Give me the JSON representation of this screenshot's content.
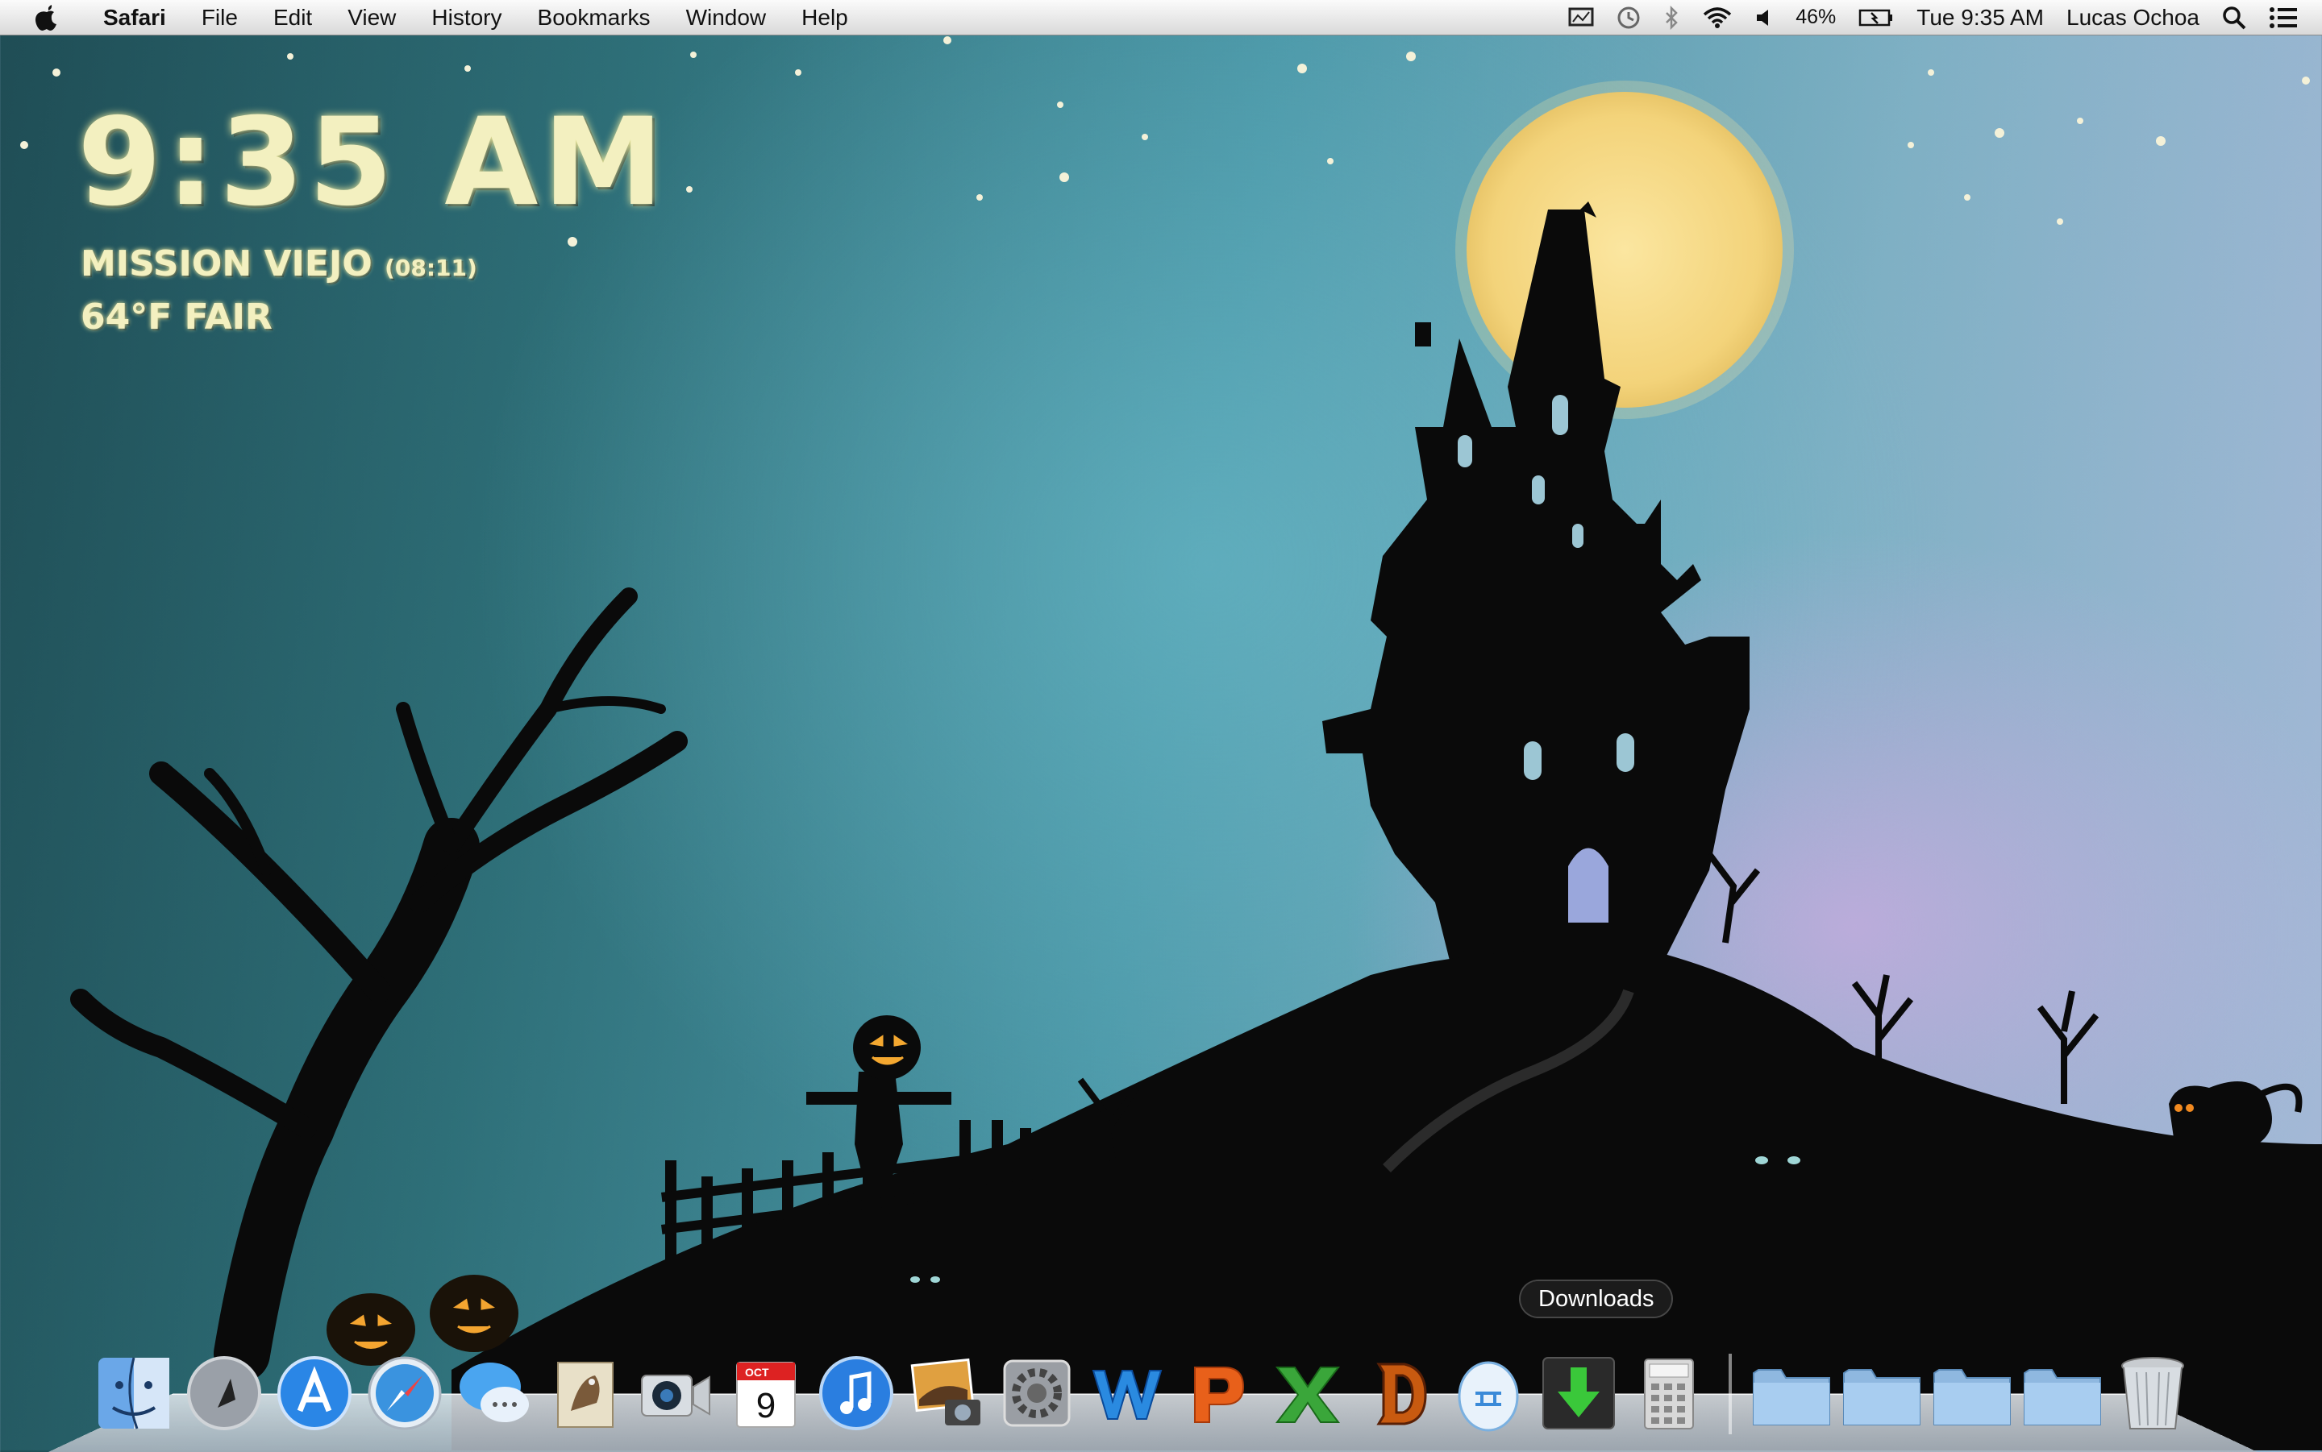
{
  "menubar": {
    "app_name": "Safari",
    "menus": [
      "File",
      "Edit",
      "View",
      "History",
      "Bookmarks",
      "Window",
      "Help"
    ],
    "battery": "46%",
    "clock": "Tue 9:35 AM",
    "user": "Lucas Ochoa",
    "status_icons": [
      "screen-icon",
      "time-machine-icon",
      "bluetooth-icon",
      "wifi-icon",
      "volume-icon",
      "battery-icon",
      "spotlight-icon",
      "notification-center-icon"
    ]
  },
  "widget": {
    "time": "9:35 AM",
    "city": "MISSION VIEJO",
    "updated": "(08:11)",
    "weather": "64°F FAIR"
  },
  "dock": {
    "tooltip": "Downloads",
    "apps": [
      "finder-icon",
      "launchpad-icon",
      "app-store-icon",
      "safari-icon",
      "messages-icon",
      "mail-icon",
      "facetime-icon",
      "calendar-icon",
      "itunes-icon",
      "iphoto-icon",
      "system-preferences-icon",
      "word-icon",
      "powerpoint-icon",
      "excel-icon",
      "diablo-icon",
      "gemini-icon",
      "downloads-app-icon",
      "calculator-icon"
    ],
    "calendar_month": "OCT",
    "calendar_day": "9",
    "folders": [
      "folder-1-icon",
      "folder-2-icon",
      "folder-3-icon",
      "folder-4-icon"
    ],
    "trash": "trash-icon"
  },
  "colors": {
    "moon": "#f9dd86",
    "silhouette": "#0a0a0a",
    "widget_text": "#f3f0c0"
  }
}
